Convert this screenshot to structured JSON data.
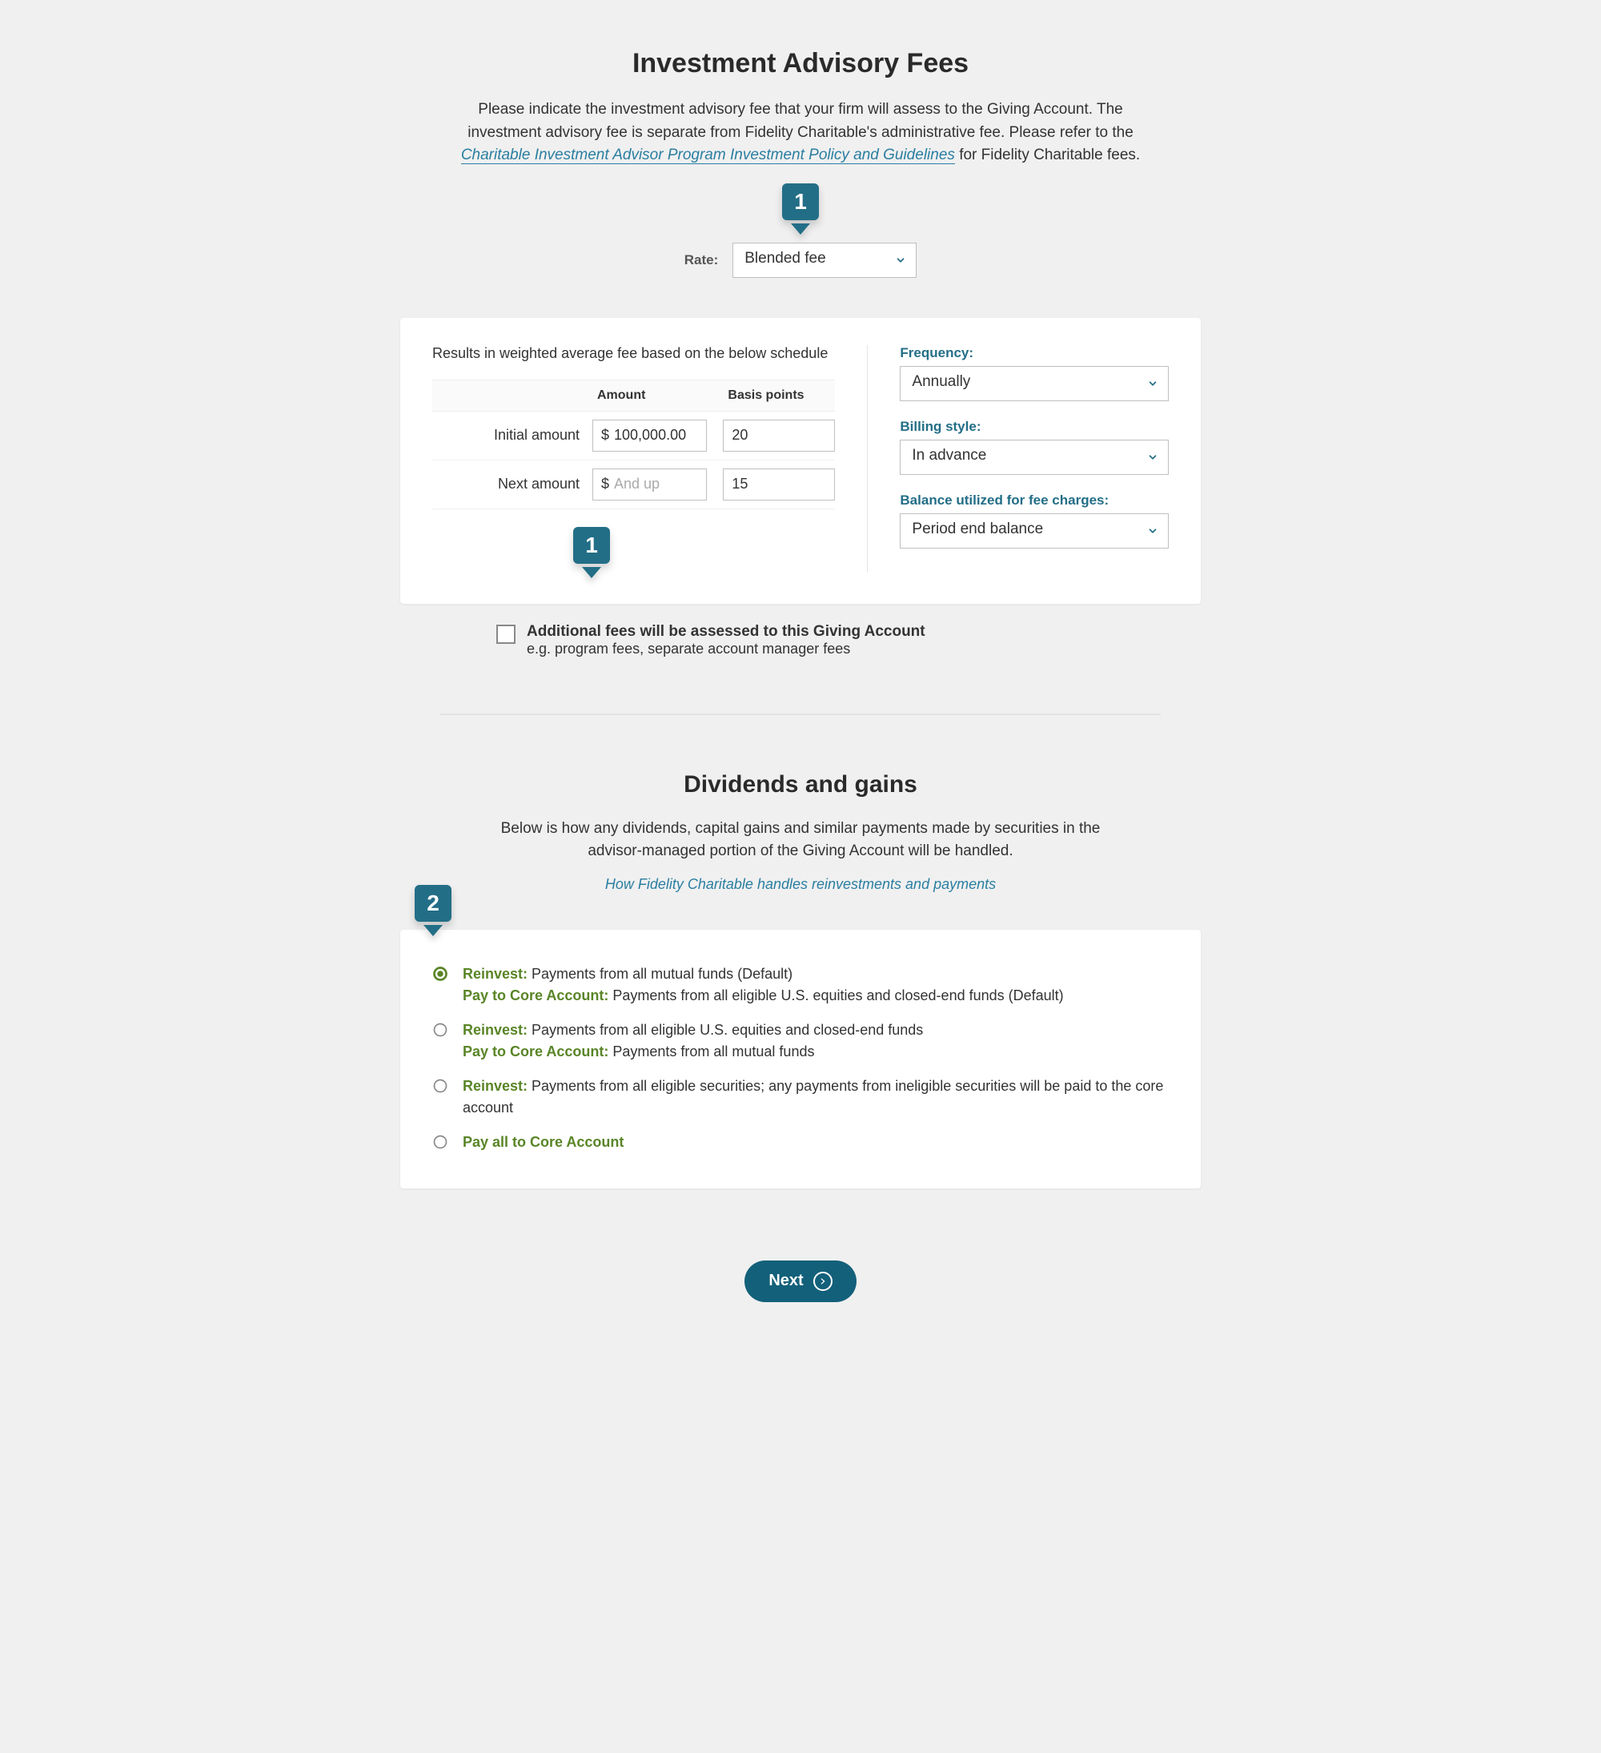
{
  "colors": {
    "teal": "#236e87",
    "green": "#598527",
    "link": "#2a7ea1"
  },
  "fees": {
    "title": "Investment Advisory Fees",
    "intro_pre": "Please indicate the investment advisory fee that your firm will assess to the Giving Account. The investment advisory fee is separate from Fidelity Charitable's administrative fee. Please refer to the ",
    "policy_link": "Charitable Investment Advisor Program Investment Policy and Guidelines",
    "intro_post": " for Fidelity Charitable fees.",
    "rate_label": "Rate:",
    "rate_value": "Blended fee",
    "callout_1": "1",
    "schedule_desc": "Results in weighted average fee based on the below schedule",
    "headers": {
      "amount": "Amount",
      "bp": "Basis points"
    },
    "rows": [
      {
        "label": "Initial amount",
        "amount": "100,000.00",
        "bp": "20"
      },
      {
        "label": "Next amount",
        "amount": "",
        "amount_ph": "And up",
        "bp": "15"
      }
    ],
    "frequency_label": "Frequency:",
    "frequency_value": "Annually",
    "billing_label": "Billing style:",
    "billing_value": "In advance",
    "balance_label": "Balance utilized for fee charges:",
    "balance_value": "Period end balance",
    "addfees_title": "Additional fees will be assessed to this Giving Account",
    "addfees_sub": "e.g. program fees, separate account manager fees"
  },
  "dividends": {
    "title": "Dividends and gains",
    "intro": "Below is how any dividends, capital gains and similar payments made by securities in the advisor-managed portion of the Giving Account will be handled.",
    "link": "How Fidelity Charitable handles reinvestments and payments",
    "callout_2": "2",
    "options": [
      {
        "checked": true,
        "lines": [
          {
            "k": "Reinvest:",
            "t": " Payments from all mutual funds (Default)"
          },
          {
            "k": "Pay to Core Account:",
            "t": " Payments from all eligible U.S. equities and closed-end funds (Default)"
          }
        ]
      },
      {
        "checked": false,
        "lines": [
          {
            "k": "Reinvest:",
            "t": " Payments from all eligible U.S. equities and closed-end funds"
          },
          {
            "k": "Pay to Core Account:",
            "t": " Payments from all mutual funds"
          }
        ]
      },
      {
        "checked": false,
        "lines": [
          {
            "k": "Reinvest:",
            "t": " Payments from all eligible securities; any payments from ineligible securities will be paid to the core account"
          }
        ]
      },
      {
        "checked": false,
        "lines": [
          {
            "k": "Pay all to Core Account",
            "t": ""
          }
        ]
      }
    ]
  },
  "cta": {
    "next": "Next"
  }
}
